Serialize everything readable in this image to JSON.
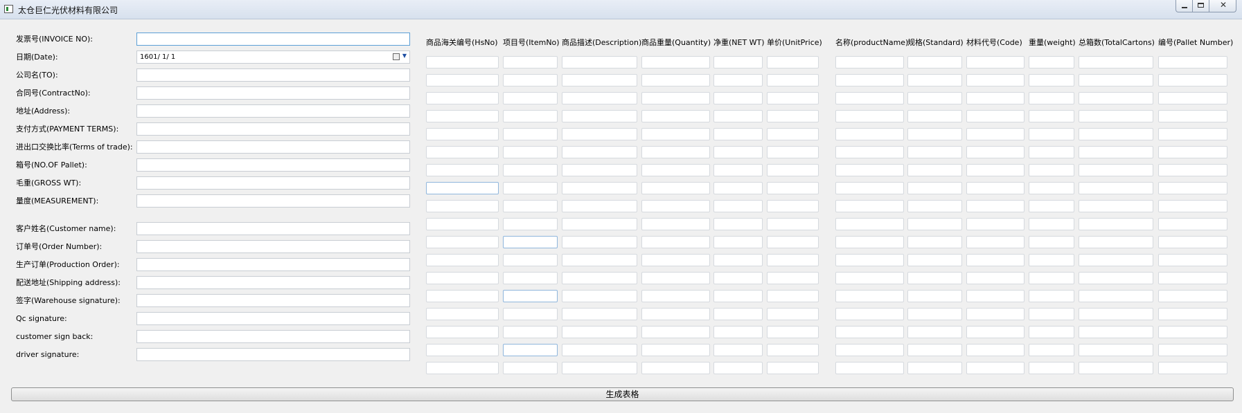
{
  "window": {
    "title": "太仓巨仁光伏材料有限公司"
  },
  "form": {
    "fields": [
      {
        "label": "发票号(INVOICE NO):",
        "value": ""
      },
      {
        "label": "日期(Date):",
        "value": "1601/  1/  1"
      },
      {
        "label": "公司名(TO):",
        "value": ""
      },
      {
        "label": "合同号(ContractNo):",
        "value": ""
      },
      {
        "label": "地址(Address):",
        "value": ""
      },
      {
        "label": "支付方式(PAYMENT TERMS):",
        "value": ""
      },
      {
        "label": "进出口交换比率(Terms of trade):",
        "value": ""
      },
      {
        "label": "箱号(NO.OF Pallet):",
        "value": ""
      },
      {
        "label": "毛重(GROSS WT):",
        "value": ""
      },
      {
        "label": "量度(MEASUREMENT):",
        "value": ""
      },
      {
        "label": "客户姓名(Customer name):",
        "value": ""
      },
      {
        "label": "订单号(Order Number):",
        "value": ""
      },
      {
        "label": "生产订单(Production Order):",
        "value": ""
      },
      {
        "label": "配送地址(Shipping address):",
        "value": ""
      },
      {
        "label": "签字(Warehouse signature):",
        "value": ""
      },
      {
        "label": "Qc signature:",
        "value": ""
      },
      {
        "label": "customer sign back:",
        "value": ""
      },
      {
        "label": "driver signature:",
        "value": ""
      }
    ]
  },
  "grid": {
    "columns": [
      "商品海关编号(HsNo)",
      "项目号(ItemNo)",
      "商品描述(Description)",
      "商品重量(Quantity)",
      "净重(NET WT)",
      "单价(UnitPrice)",
      "名称(productName)",
      "规格(Standard)",
      "材料代号(Code)",
      "重量(weight)",
      "总箱数(TotalCartons)",
      "编号(Pallet Number)"
    ],
    "row_count": 18
  },
  "actions": {
    "generate_label": "生成表格"
  },
  "icons": {
    "app": "app-icon",
    "date_picker": "calendar-icon",
    "dropdown": "chevron-down-icon",
    "minimize": "minimize-icon",
    "maximize": "maximize-icon",
    "close": "close-icon"
  }
}
